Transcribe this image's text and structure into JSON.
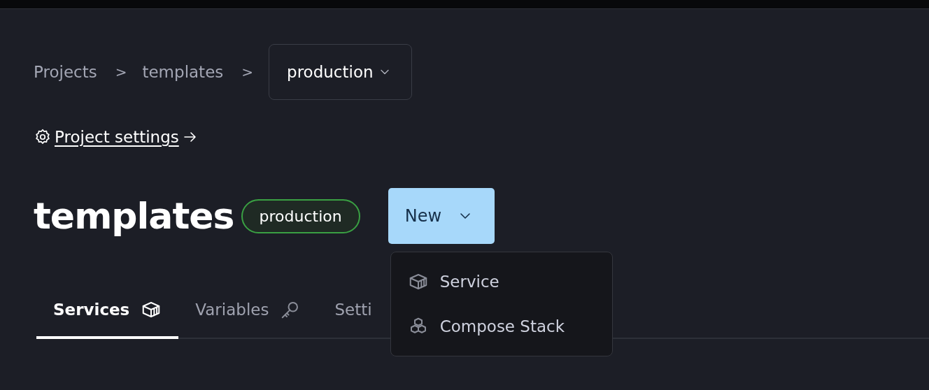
{
  "breadcrumb": {
    "items": [
      "Projects",
      "templates"
    ],
    "separator": ">",
    "environment": "production"
  },
  "settings_link": {
    "label": "Project settings"
  },
  "heading": {
    "title": "templates",
    "badge": "production"
  },
  "new_button": {
    "label": "New",
    "expanded": true
  },
  "tabs": [
    {
      "label": "Services",
      "kind": "box",
      "selected": true
    },
    {
      "label": "Variables",
      "kind": "key",
      "selected": false
    },
    {
      "label": "Setti",
      "kind": "plain",
      "selected": false
    }
  ],
  "menu": [
    {
      "label": "Service",
      "kind": "box"
    },
    {
      "label": "Compose Stack",
      "kind": "boxes"
    }
  ]
}
